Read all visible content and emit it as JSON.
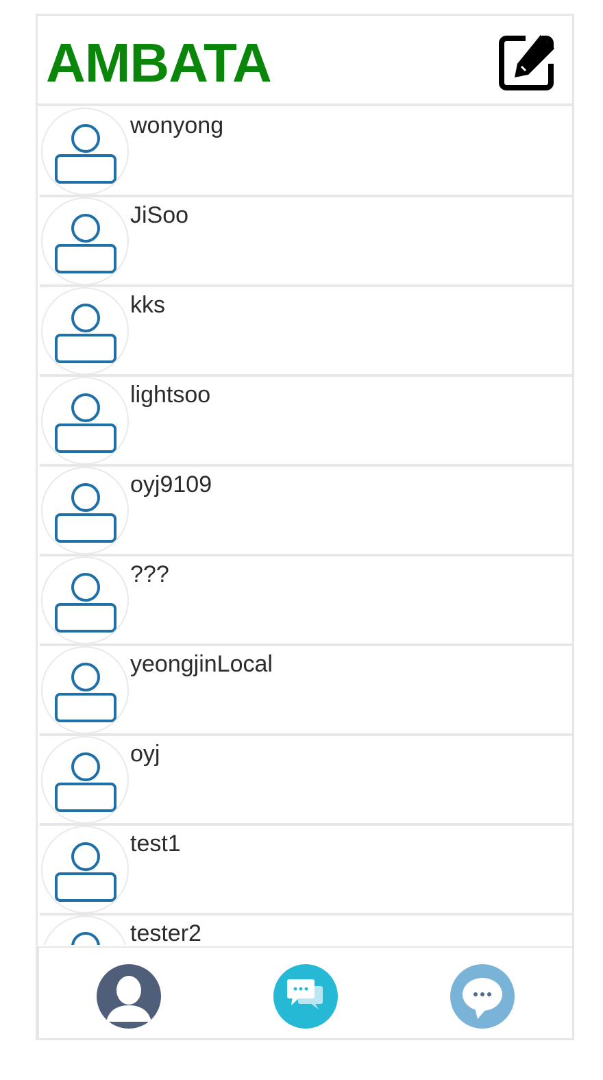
{
  "app": {
    "title": "AMBATA"
  },
  "header": {
    "compose_icon": "edit-square-icon"
  },
  "friends": [
    {
      "name": "wonyong"
    },
    {
      "name": "JiSoo"
    },
    {
      "name": "kks"
    },
    {
      "name": "lightsoo"
    },
    {
      "name": "oyj9109"
    },
    {
      "name": "???"
    },
    {
      "name": "yeongjinLocal"
    },
    {
      "name": "oyj"
    },
    {
      "name": "test1"
    },
    {
      "name": "tester2"
    }
  ],
  "nav": {
    "items": [
      {
        "icon": "person-icon",
        "color": "#4f5f7a"
      },
      {
        "icon": "chat-bubbles-icon",
        "color": "#25b9d6"
      },
      {
        "icon": "speech-bubble-icon",
        "color": "#79b3d8"
      }
    ]
  },
  "colors": {
    "brand": "#0a870a",
    "avatar_stroke": "#1f6fa8",
    "divider": "#e9e6e6"
  }
}
